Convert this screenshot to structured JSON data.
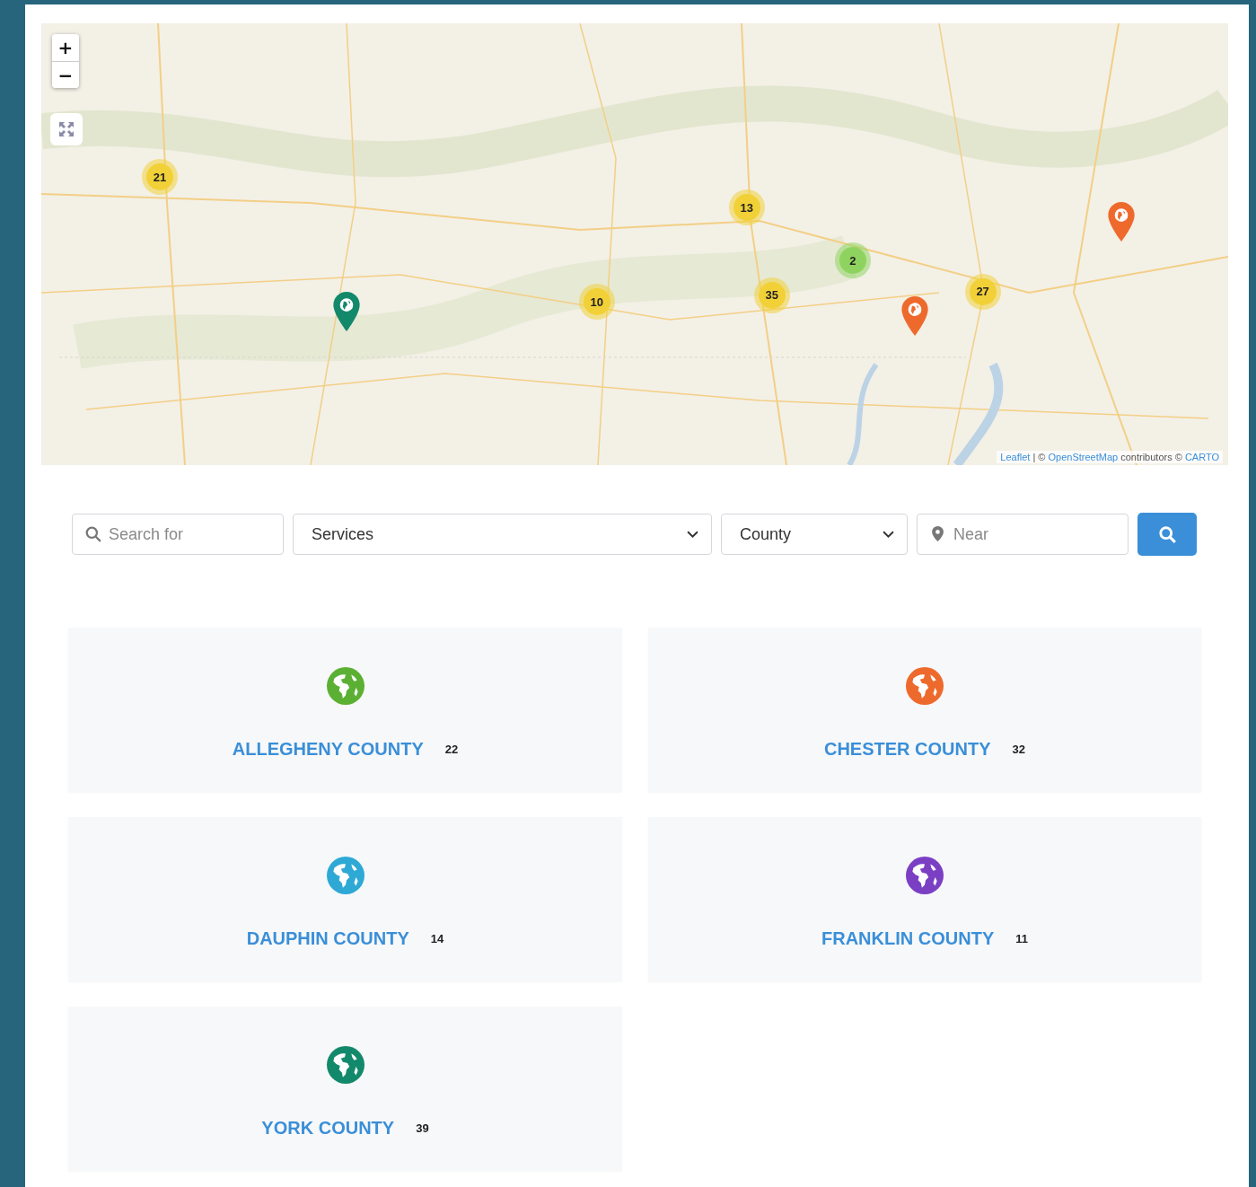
{
  "map": {
    "zoom_in": "+",
    "zoom_out": "−",
    "clusters": [
      {
        "count": "21",
        "color": "#f2d138"
      },
      {
        "count": "13",
        "color": "#f2d138"
      },
      {
        "count": "10",
        "color": "#f2d138"
      },
      {
        "count": "35",
        "color": "#f2d138"
      },
      {
        "count": "2",
        "color": "#8ed35f"
      },
      {
        "count": "27",
        "color": "#f2d138"
      }
    ],
    "pins": [
      {
        "color": "#13896b"
      },
      {
        "color": "#ee6a2c"
      },
      {
        "color": "#ee6a2c"
      }
    ],
    "attribution": [
      {
        "text": "Leaflet",
        "link": true
      },
      {
        "text": " | © ",
        "link": false
      },
      {
        "text": "OpenStreetMap",
        "link": true
      },
      {
        "text": " contributors © ",
        "link": false
      },
      {
        "text": "CARTO",
        "link": true
      }
    ]
  },
  "filters": {
    "search": {
      "placeholder": "Search for"
    },
    "services": {
      "value": "Services"
    },
    "county": {
      "value": "County"
    },
    "near": {
      "placeholder": "Near"
    }
  },
  "counties": [
    {
      "name": "ALLEGHENY COUNTY",
      "count": "22",
      "color": "#5bb033"
    },
    {
      "name": "CHESTER COUNTY",
      "count": "32",
      "color": "#ee6a2c"
    },
    {
      "name": "DAUPHIN COUNTY",
      "count": "14",
      "color": "#2ea9d6"
    },
    {
      "name": "FRANKLIN COUNTY",
      "count": "11",
      "color": "#7b3fc4"
    },
    {
      "name": "YORK COUNTY",
      "count": "39",
      "color": "#13896b"
    }
  ]
}
